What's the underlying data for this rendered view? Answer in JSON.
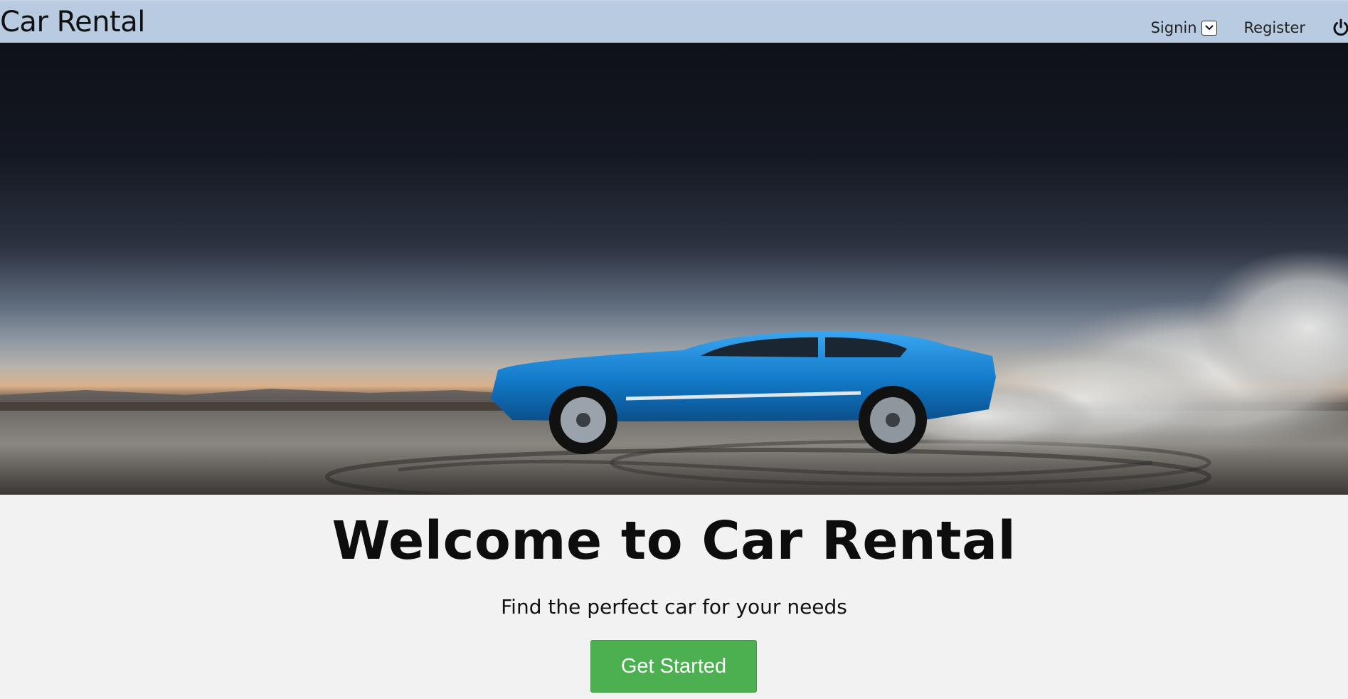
{
  "navbar": {
    "brand": "Car Rental",
    "signin_label": "Signin",
    "register_label": "Register",
    "background": "#b9cbe0"
  },
  "hero": {
    "icon": "car-hero-image"
  },
  "content": {
    "headline": "Welcome to Car Rental",
    "subtitle": "Find the perfect car for your needs",
    "cta_label": "Get Started",
    "cta_color": "#4caf50"
  }
}
